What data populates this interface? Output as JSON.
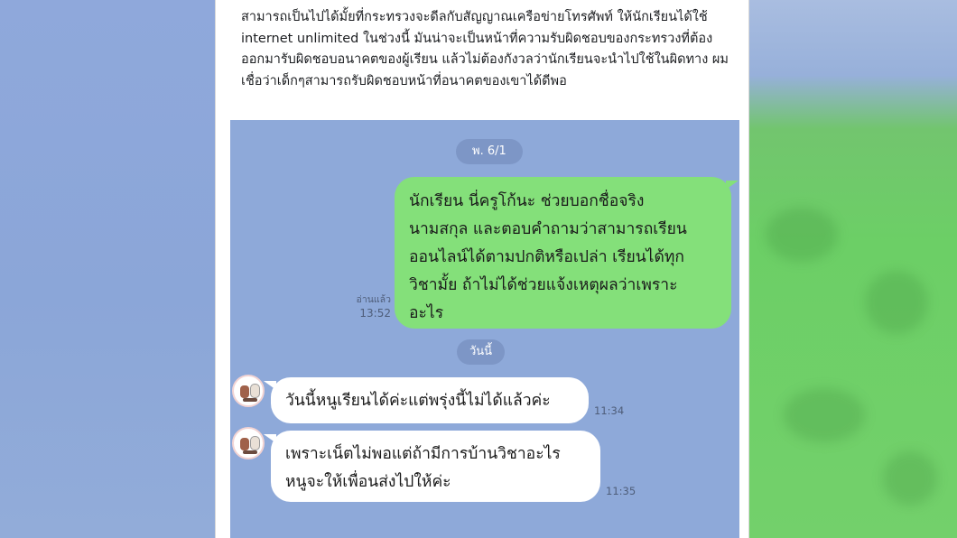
{
  "post": {
    "text": "สามารถเป็นไปได้มั้ยที่กระทรวงจะดีลกับสัญญาณเครือข่ายโทรศัพท์ ให้นักเรียนได้ใช้ internet unlimited ในช่วงนี้ มันน่าจะเป็นหน้าที่ความรับผิดชอบของกระทรวงที่ต้องออกมารับผิดชอบอนาคตของผู้เรียน แล้วไม่ต้องกังวลว่านักเรียนจะนำไปใช้ในผิดทาง ผมเชื่อว่าเด็กๆสามารถรับผิดชอบหน้าที่อนาคตของเขาได้ดีพอ"
  },
  "chat": {
    "date_label_1": "พ. 6/1",
    "outgoing_message": "นักเรียน นี่ครูโก้นะ ช่วยบอกชื่อจริง\nนามสกุล และตอบคำถามว่าสามารถเรียน\nออนไลน์ได้ตามปกติหรือเปล่า เรียนได้ทุก\nวิชามั้ย ถ้าไม่ได้ช่วยแจ้งเหตุผลว่าเพราะ\nอะไร",
    "read_label": "อ่านแล้ว",
    "outgoing_time": "13:52",
    "date_label_2": "วันนี้",
    "incoming": [
      {
        "text": "วันนี้หนูเรียนได้ค่ะแต่พรุ่งนี้ไม่ได้แล้วค่ะ",
        "time": "11:34"
      },
      {
        "text": "เพราะเน็ตไม่พอแต่ถ้ามีการบ้านวิชาอะไร\nหนูจะให้เพื่อนส่งไปให้ค่ะ",
        "time": "11:35"
      }
    ],
    "colors": {
      "chat_background": "#8ea9d9",
      "outgoing_bubble": "#84e07a",
      "incoming_bubble": "#ffffff",
      "date_badge": "#7d96c6"
    }
  }
}
